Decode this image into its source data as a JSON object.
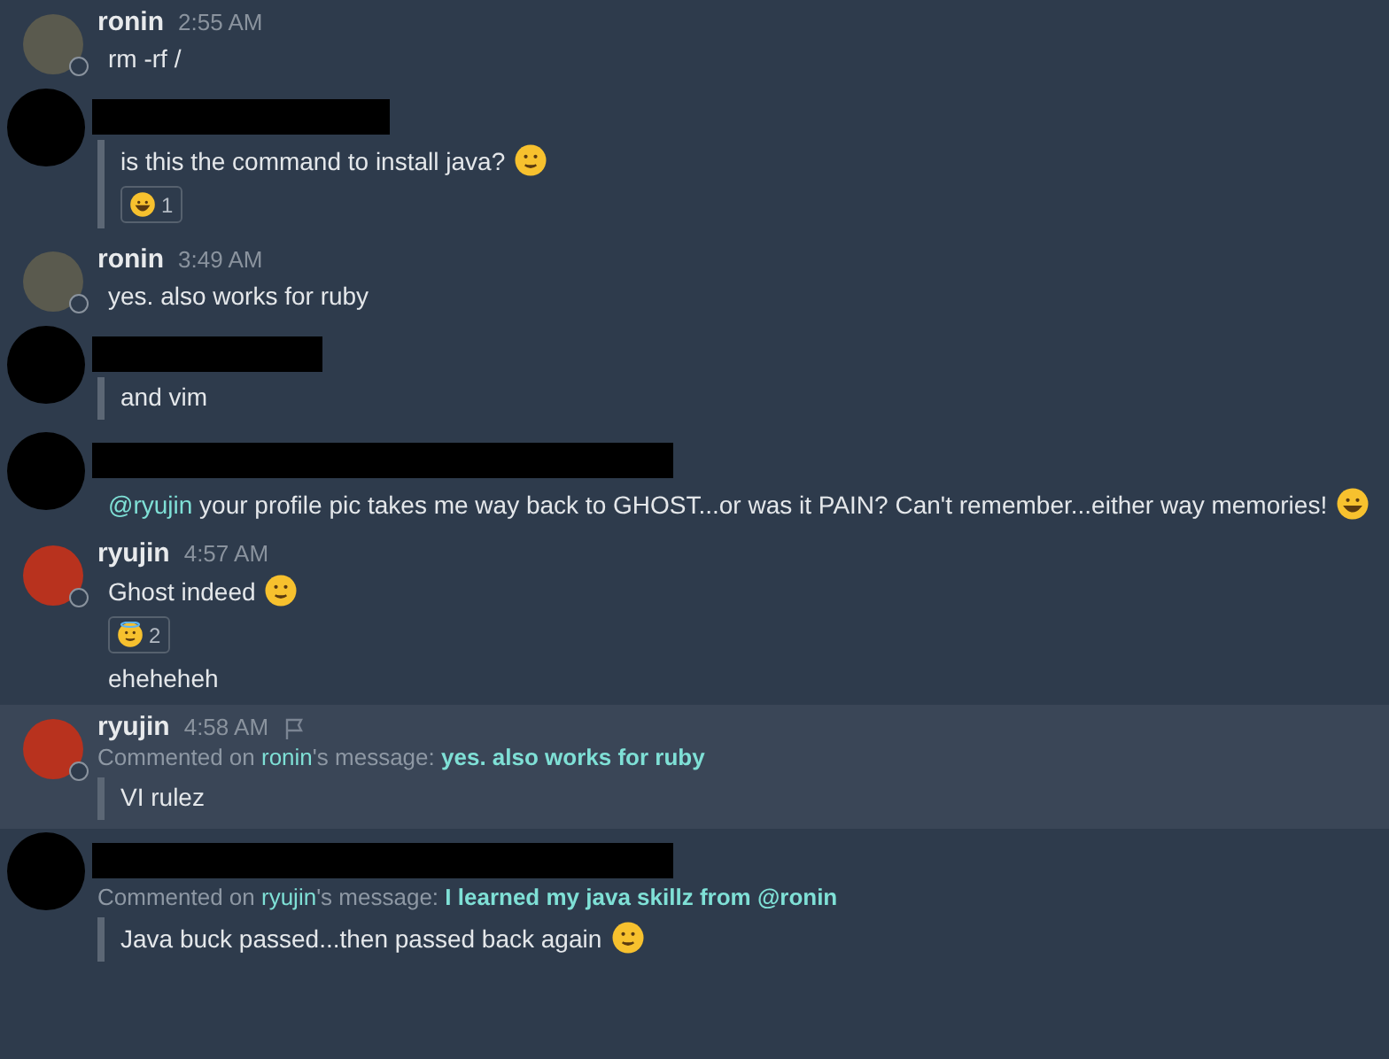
{
  "messages": [
    {
      "kind": "named",
      "author": "ronin",
      "time": "2:55 AM",
      "color": "#5a5a4e",
      "highlighted": false,
      "items": [
        {
          "kind": "plain",
          "text": "rm -rf /"
        }
      ]
    },
    {
      "kind": "redacted_medium",
      "items": [
        {
          "kind": "quote",
          "text": "is this the command to install java?",
          "emoji": {
            "kind": "smile"
          },
          "reaction": {
            "emoji": {
              "kind": "laugh"
            },
            "count": "1"
          }
        }
      ]
    },
    {
      "kind": "named",
      "author": "ronin",
      "time": "3:49 AM",
      "color": "#5a5a4e",
      "highlighted": false,
      "items": [
        {
          "kind": "plain",
          "text": "yes. also works for ruby"
        }
      ]
    },
    {
      "kind": "redacted_short",
      "items": [
        {
          "kind": "quote",
          "text": "and vim"
        }
      ]
    },
    {
      "kind": "redacted_long",
      "items": [
        {
          "kind": "plain",
          "mention": "@ryujin",
          "text": " your profile pic takes me way back to GHOST...or was it PAIN? Can't remember...either way memories!",
          "emoji": {
            "kind": "grin"
          }
        }
      ]
    },
    {
      "kind": "named",
      "author": "ryujin",
      "time": "4:57 AM",
      "color": "#b8321e",
      "highlighted": false,
      "items": [
        {
          "kind": "plain",
          "text": "Ghost indeed",
          "emoji": {
            "kind": "smile"
          },
          "reaction": {
            "emoji": {
              "kind": "halo"
            },
            "count": "2"
          }
        },
        {
          "kind": "plain",
          "text": "eheheheh"
        }
      ]
    },
    {
      "kind": "named",
      "author": "ryujin",
      "time": "4:58 AM",
      "color": "#b8321e",
      "highlighted": true,
      "comment": {
        "prefix": "Commented on",
        "user": "ronin",
        "middle": "'s message:",
        "quote": "yes. also works for ruby"
      },
      "items": [
        {
          "kind": "quote",
          "text": "VI rulez"
        }
      ]
    },
    {
      "kind": "redacted_long",
      "comment": {
        "prefix": "Commented on",
        "user": "ryujin",
        "middle": "'s message:",
        "quote": "I learned my java skillz from @ronin"
      },
      "items": [
        {
          "kind": "quote",
          "text": "Java buck passed...then passed back again",
          "emoji": {
            "kind": "smile"
          }
        }
      ]
    }
  ]
}
